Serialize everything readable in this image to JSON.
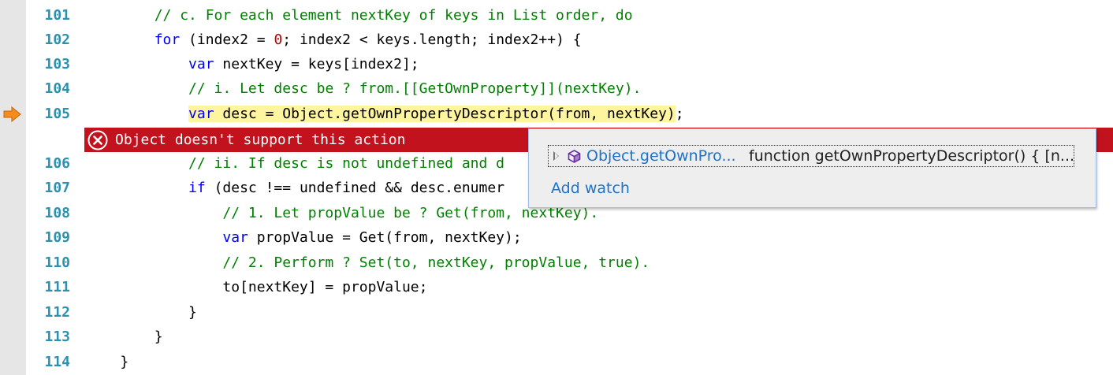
{
  "editor": {
    "current_line_indicator": "arrow-icon",
    "lines": [
      {
        "num": "101",
        "parts": [
          [
            "ws",
            "        "
          ],
          [
            "cm",
            "// c. For each element nextKey of keys in List order, do"
          ]
        ]
      },
      {
        "num": "102",
        "parts": [
          [
            "ws",
            "        "
          ],
          [
            "kw",
            "for"
          ],
          [
            "tx",
            " (index2 = "
          ],
          [
            "num",
            "0"
          ],
          [
            "tx",
            "; index2 < keys.length; index2++) {"
          ]
        ]
      },
      {
        "num": "103",
        "parts": [
          [
            "ws",
            "            "
          ],
          [
            "kw",
            "var"
          ],
          [
            "tx",
            " nextKey = keys[index2];"
          ]
        ]
      },
      {
        "num": "104",
        "parts": [
          [
            "ws",
            "            "
          ],
          [
            "cm",
            "// i. Let desc be ? from.[[GetOwnProperty]](nextKey)."
          ]
        ]
      },
      {
        "num": "105",
        "parts": [
          [
            "ws",
            "            "
          ],
          [
            "hlkw",
            "var"
          ],
          [
            "hl",
            " desc = Object.getOwnPropertyDescriptor(from, nextKey)"
          ],
          [
            "tx",
            ";"
          ]
        ]
      },
      {
        "num": "106",
        "parts": [
          [
            "ws",
            "            "
          ],
          [
            "cm",
            "// ii. If desc is not undefined and d"
          ]
        ]
      },
      {
        "num": "107",
        "parts": [
          [
            "ws",
            "            "
          ],
          [
            "kw",
            "if"
          ],
          [
            "tx",
            " (desc !== undefined && desc.enumer"
          ]
        ]
      },
      {
        "num": "108",
        "parts": [
          [
            "ws",
            "                "
          ],
          [
            "cm",
            "// 1. Let propValue be ? Get(from, nextKey)."
          ]
        ]
      },
      {
        "num": "109",
        "parts": [
          [
            "ws",
            "                "
          ],
          [
            "kw",
            "var"
          ],
          [
            "tx",
            " propValue = Get(from, nextKey);"
          ]
        ]
      },
      {
        "num": "110",
        "parts": [
          [
            "ws",
            "                "
          ],
          [
            "cm",
            "// 2. Perform ? Set(to, nextKey, propValue, true)."
          ]
        ]
      },
      {
        "num": "111",
        "parts": [
          [
            "ws",
            "                "
          ],
          [
            "tx",
            "to[nextKey] = propValue;"
          ]
        ]
      },
      {
        "num": "112",
        "parts": [
          [
            "ws",
            "            "
          ],
          [
            "tx",
            "}"
          ]
        ]
      },
      {
        "num": "113",
        "parts": [
          [
            "ws",
            "        "
          ],
          [
            "tx",
            "}"
          ]
        ]
      },
      {
        "num": "114",
        "parts": [
          [
            "ws",
            "    "
          ],
          [
            "tx",
            "}"
          ]
        ]
      }
    ]
  },
  "error": {
    "icon": "error-circle-icon",
    "message": "Object doesn't support this action"
  },
  "datatip": {
    "expand_icon": "expand-triangle-icon",
    "type_icon": "method-cube-icon",
    "name": "Object.getOwnPro...",
    "value": "function getOwnPropertyDescriptor() { [n...",
    "add_watch": "Add watch"
  },
  "colors": {
    "keyword": "#0000ff",
    "comment": "#008000",
    "number": "#c00000",
    "line_number": "#2b91af",
    "error_bar": "#c1121e",
    "highlight": "#fff59e",
    "link": "#1e73c8"
  }
}
